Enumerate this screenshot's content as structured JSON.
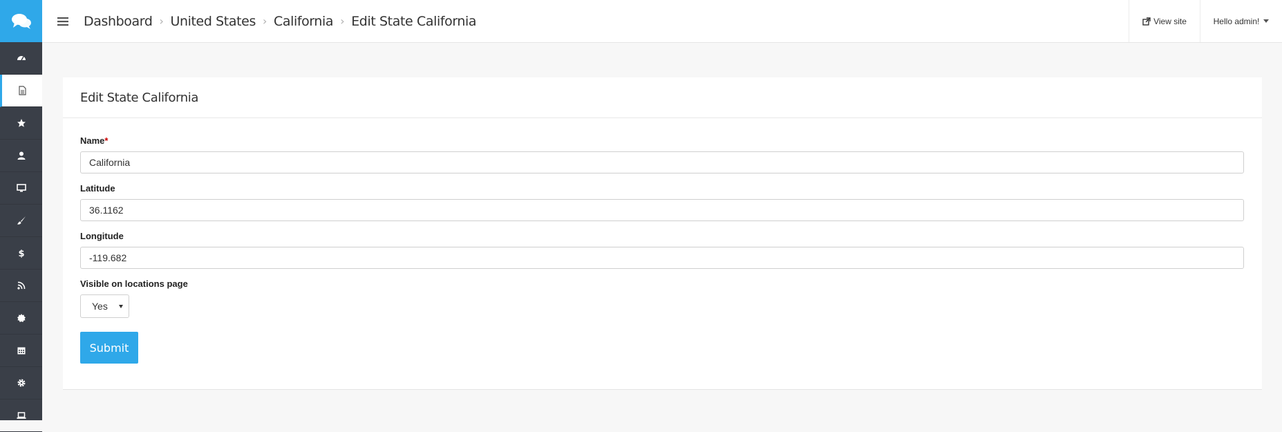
{
  "header": {
    "breadcrumbs": [
      "Dashboard",
      "United States",
      "California",
      "Edit State California"
    ],
    "view_site": "View site",
    "user_greeting": "Hello admin!"
  },
  "sidebar": {
    "items": [
      {
        "icon": "dashboard-icon"
      },
      {
        "icon": "document-icon",
        "active": true
      },
      {
        "icon": "star-icon"
      },
      {
        "icon": "user-icon"
      },
      {
        "icon": "desktop-icon"
      },
      {
        "icon": "paint-brush-icon"
      },
      {
        "icon": "dollar-icon"
      },
      {
        "icon": "rss-icon"
      },
      {
        "icon": "badge-icon"
      },
      {
        "icon": "calendar-icon"
      },
      {
        "icon": "gear-icon"
      },
      {
        "icon": "laptop-icon"
      }
    ],
    "accent": "#2fa8e9",
    "background": "#3a3f48"
  },
  "form": {
    "title": "Edit State California",
    "name_label": "Name",
    "required_mark": "*",
    "name_value": "California",
    "latitude_label": "Latitude",
    "latitude_value": "36.1162",
    "longitude_label": "Longitude",
    "longitude_value": "-119.682",
    "visible_label": "Visible on locations page",
    "visible_value": "Yes",
    "submit_label": "Submit"
  }
}
